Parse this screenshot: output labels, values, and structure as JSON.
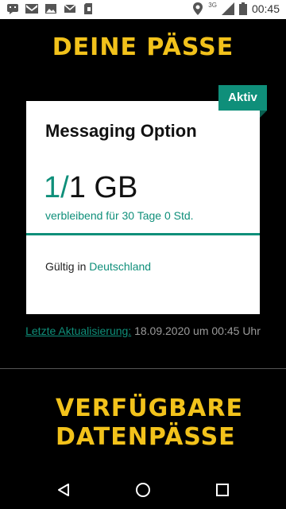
{
  "status_bar": {
    "time": "00:45",
    "network": "3G",
    "left_icons": [
      "message-icon",
      "gmail-icon",
      "image-icon",
      "mail-icon",
      "sim-icon"
    ],
    "right_icons": [
      "location-icon",
      "signal-icon",
      "battery-icon"
    ]
  },
  "page": {
    "heading_passes": "DEINE PÄSSE",
    "heading_available": "VERFÜGBARE DATENPÄSSE"
  },
  "pass_card": {
    "status_badge": "Aktiv",
    "title": "Messaging Option",
    "remaining": "1",
    "separator": "/",
    "total": "1 GB",
    "remaining_fraction": 1.0,
    "remaining_text": "verbleibend für 30 Tage 0 Std.",
    "valid_prefix": "Gültig in",
    "valid_country": "Deutschland"
  },
  "update": {
    "link_label": "Letzte Aktualisierung:",
    "timestamp": "18.09.2020 um 00:45 Uhr"
  },
  "nav": {
    "back": "back-icon",
    "home": "home-icon",
    "recents": "recents-icon"
  },
  "colors": {
    "accent": "#0f8f7a",
    "heading": "#f2c21b",
    "background": "#000000"
  }
}
